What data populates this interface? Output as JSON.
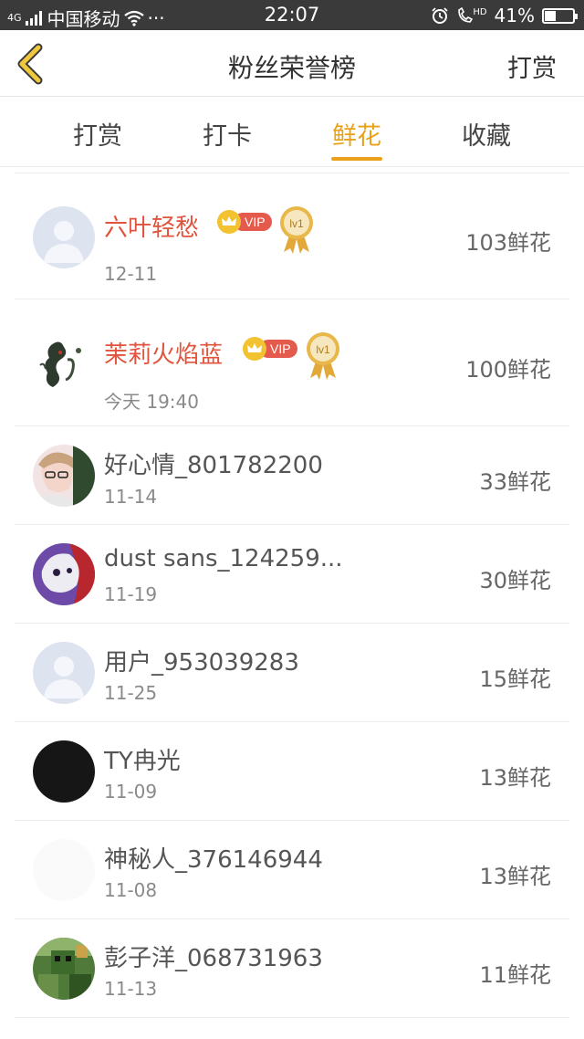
{
  "status_bar": {
    "network_label": "4G",
    "carrier": "中国移动",
    "more": "···",
    "time": "22:07",
    "hd_label": "HD",
    "battery_text": "41%",
    "battery_level": 0.41
  },
  "header": {
    "title": "粉丝荣誉榜",
    "reward_link": "打赏"
  },
  "tabs": [
    {
      "label": "打赏",
      "active": false
    },
    {
      "label": "打卡",
      "active": false
    },
    {
      "label": "鲜花",
      "active": true
    },
    {
      "label": "收藏",
      "active": false
    }
  ],
  "vip_label": "VIP",
  "medal_label": "lv1",
  "list": [
    {
      "name": "六叶轻愁",
      "date": "12-11",
      "amount": "103鲜花",
      "vip": true
    },
    {
      "name": "茉莉火焰蓝",
      "date": "今天 19:40",
      "amount": "100鲜花",
      "vip": true
    },
    {
      "name": "好心情_801782200",
      "date": "11-14",
      "amount": "33鲜花",
      "vip": false
    },
    {
      "name": "dust sans_124259...",
      "date": "11-19",
      "amount": "30鲜花",
      "vip": false
    },
    {
      "name": "用户_953039283",
      "date": "11-25",
      "amount": "15鲜花",
      "vip": false
    },
    {
      "name": "TY冉光",
      "date": "11-09",
      "amount": "13鲜花",
      "vip": false
    },
    {
      "name": "神秘人_376146944",
      "date": "11-08",
      "amount": "13鲜花",
      "vip": false
    },
    {
      "name": "彭子洋_068731963",
      "date": "11-13",
      "amount": "11鲜花",
      "vip": false
    }
  ],
  "colors": {
    "accent": "#e9a11a",
    "vip_name": "#e0533c",
    "status_bar": "#3a3a3a"
  }
}
